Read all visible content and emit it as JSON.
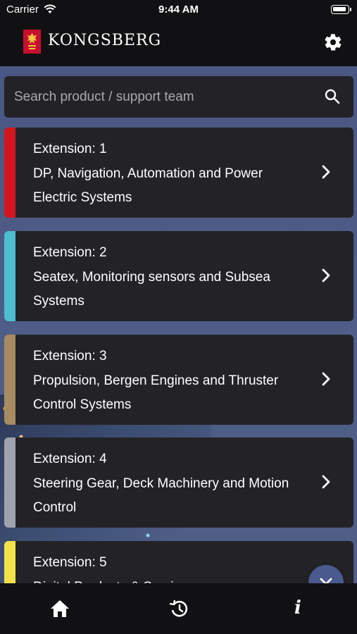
{
  "status_bar": {
    "carrier": "Carrier",
    "time": "9:44 AM"
  },
  "header": {
    "brand": "KONGSBERG",
    "icons": {
      "settings": "gear-icon",
      "logo": "kongsberg-logo-icon"
    }
  },
  "search": {
    "placeholder": "Search product / support team",
    "value": "",
    "icon": "search-icon"
  },
  "extensions": [
    {
      "extension_label": "Extension: 1",
      "title": "DP, Navigation, Automation and Power Electric Systems",
      "accent_color": "#d3161e"
    },
    {
      "extension_label": "Extension: 2",
      "title": "Seatex, Monitoring sensors and Subsea Systems",
      "accent_color": "#4ebfce"
    },
    {
      "extension_label": "Extension: 3",
      "title": "Propulsion, Bergen Engines and Thruster Control Systems",
      "accent_color": "#a78b62"
    },
    {
      "extension_label": "Extension: 4",
      "title": "Steering Gear, Deck Machinery and Motion Control",
      "accent_color": "#9ea3ad"
    },
    {
      "extension_label": "Extension: 5",
      "title": "Digital Products & Services",
      "accent_color": "#f1e24a"
    }
  ],
  "scroll_down_button": {
    "icon": "chevron-down-icon",
    "color": "#4b5a8e"
  },
  "tab_bar": {
    "items": [
      {
        "icon": "home-icon"
      },
      {
        "icon": "history-icon"
      },
      {
        "icon": "info-icon"
      }
    ]
  }
}
